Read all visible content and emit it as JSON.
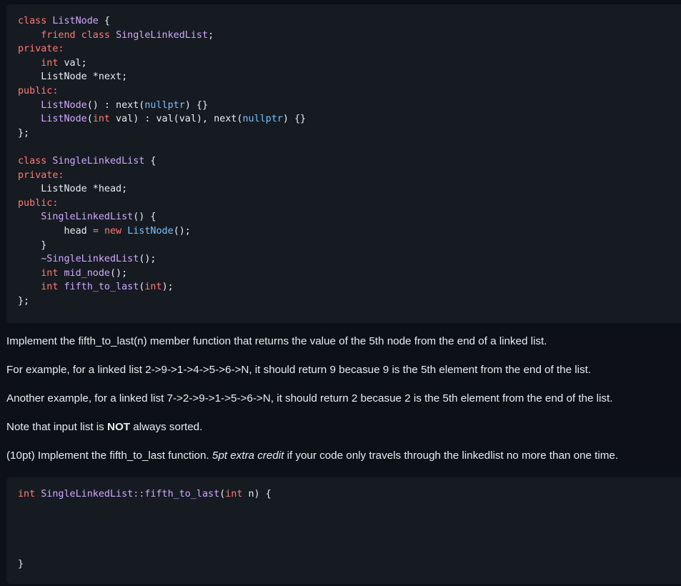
{
  "code_block_1": {
    "lines": [
      [
        [
          "kw",
          "class "
        ],
        [
          "ty",
          "ListNode"
        ],
        [
          "pl",
          " {"
        ]
      ],
      [
        [
          "pl",
          "    "
        ],
        [
          "kw",
          "friend class "
        ],
        [
          "ty",
          "SingleLinkedList"
        ],
        [
          "pl",
          ";"
        ]
      ],
      [
        [
          "kw",
          "private:"
        ]
      ],
      [
        [
          "pl",
          "    "
        ],
        [
          "kw",
          "int"
        ],
        [
          "pl",
          " val;"
        ]
      ],
      [
        [
          "pl",
          "    ListNode *next;"
        ]
      ],
      [
        [
          "kw",
          "public:"
        ]
      ],
      [
        [
          "pl",
          "    "
        ],
        [
          "ty",
          "ListNode"
        ],
        [
          "pl",
          "() : next("
        ],
        [
          "cn",
          "nullptr"
        ],
        [
          "pl",
          ") {}"
        ]
      ],
      [
        [
          "pl",
          "    "
        ],
        [
          "ty",
          "ListNode"
        ],
        [
          "pl",
          "("
        ],
        [
          "kw",
          "int"
        ],
        [
          "pl",
          " val) : val(val), next("
        ],
        [
          "cn",
          "nullptr"
        ],
        [
          "pl",
          ") {}"
        ]
      ],
      [
        [
          "pl",
          "};"
        ]
      ],
      [
        [
          "pl",
          ""
        ]
      ],
      [
        [
          "kw",
          "class "
        ],
        [
          "ty",
          "SingleLinkedList"
        ],
        [
          "pl",
          " {"
        ]
      ],
      [
        [
          "kw",
          "private:"
        ]
      ],
      [
        [
          "pl",
          "    ListNode *head;"
        ]
      ],
      [
        [
          "kw",
          "public:"
        ]
      ],
      [
        [
          "pl",
          "    "
        ],
        [
          "ty",
          "SingleLinkedList"
        ],
        [
          "pl",
          "() {"
        ]
      ],
      [
        [
          "pl",
          "        head "
        ],
        [
          "kw",
          "="
        ],
        [
          "pl",
          " "
        ],
        [
          "kw",
          "new"
        ],
        [
          "pl",
          " "
        ],
        [
          "cn",
          "ListNode"
        ],
        [
          "pl",
          "();"
        ]
      ],
      [
        [
          "pl",
          "    }"
        ]
      ],
      [
        [
          "pl",
          "    "
        ],
        [
          "ty",
          "~SingleLinkedList"
        ],
        [
          "pl",
          "();"
        ]
      ],
      [
        [
          "pl",
          "    "
        ],
        [
          "kw",
          "int"
        ],
        [
          "pl",
          " "
        ],
        [
          "ty",
          "mid_node"
        ],
        [
          "pl",
          "();"
        ]
      ],
      [
        [
          "pl",
          "    "
        ],
        [
          "kw",
          "int"
        ],
        [
          "pl",
          " "
        ],
        [
          "ty",
          "fifth_to_last"
        ],
        [
          "pl",
          "("
        ],
        [
          "kw",
          "int"
        ],
        [
          "pl",
          ");"
        ]
      ],
      [
        [
          "pl",
          "};"
        ]
      ]
    ]
  },
  "paragraphs": {
    "p1": "Implement the fifth_to_last(n) member function that returns the value of the 5th node from the end of a linked list.",
    "p2": "For example, for a linked list 2->9->1->4->5->6->N, it should return 9 becasue 9 is the 5th element from the end of the list.",
    "p3": "Another example, for a linked list 7->2->9->1->5->6->N, it should return 2 becasue 2 is the 5th element from the end of the list.",
    "p4_a": "Note that input list is ",
    "p4_b": "NOT",
    "p4_c": " always sorted.",
    "p5_a": "(10pt) Implement the fifth_to_last function. ",
    "p5_b": "5pt extra credit",
    "p5_c": " if your code only travels through the linkedlist no more than one time."
  },
  "code_block_2": {
    "lines": [
      [
        [
          "kw",
          "int"
        ],
        [
          "pl",
          " "
        ],
        [
          "ty",
          "SingleLinkedList::fifth_to_last"
        ],
        [
          "pl",
          "("
        ],
        [
          "kw",
          "int"
        ],
        [
          "pl",
          " n) {"
        ]
      ],
      [
        [
          "pl",
          ""
        ]
      ],
      [
        [
          "pl",
          ""
        ]
      ],
      [
        [
          "pl",
          ""
        ]
      ],
      [
        [
          "pl",
          ""
        ]
      ],
      [
        [
          "pl",
          "}"
        ]
      ]
    ]
  },
  "colors": {
    "background": "#0d1117",
    "code_background": "#161b22",
    "keyword": "#ff7b72",
    "type": "#d2a8ff",
    "constant": "#79c0ff",
    "text": "#e6edf3"
  }
}
